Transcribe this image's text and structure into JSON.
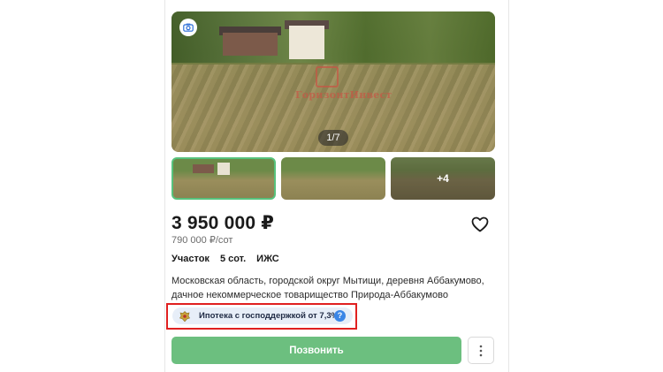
{
  "gallery": {
    "counter": "1/7",
    "watermark": "ГоризонтИнвест",
    "more_photos": "+4"
  },
  "listing": {
    "price": "3 950 000 ₽",
    "price_per_unit": "790 000 ₽/сот",
    "params": [
      "Участок",
      "5 сот.",
      "ИЖС"
    ],
    "address": "Московская область, городской округ Мытищи, деревня Аббакумово, дачное некоммерческое товарищество Природа-Аббакумово",
    "mortgage_badge": "Ипотека с господдержкой от 7,3%",
    "help_symbol": "?"
  },
  "actions": {
    "call_label": "Позвонить"
  },
  "icons": {
    "camera": "camera-icon",
    "favorite": "heart-icon",
    "menu": "more-vertical-icon",
    "emblem": "emblem-icon"
  },
  "colors": {
    "call_button": "#6cbf7f",
    "selected_thumb_border": "#57c27c",
    "badge_bg": "#e7eef8",
    "help_circle": "#3b86e6",
    "highlight_border": "#e02020"
  }
}
